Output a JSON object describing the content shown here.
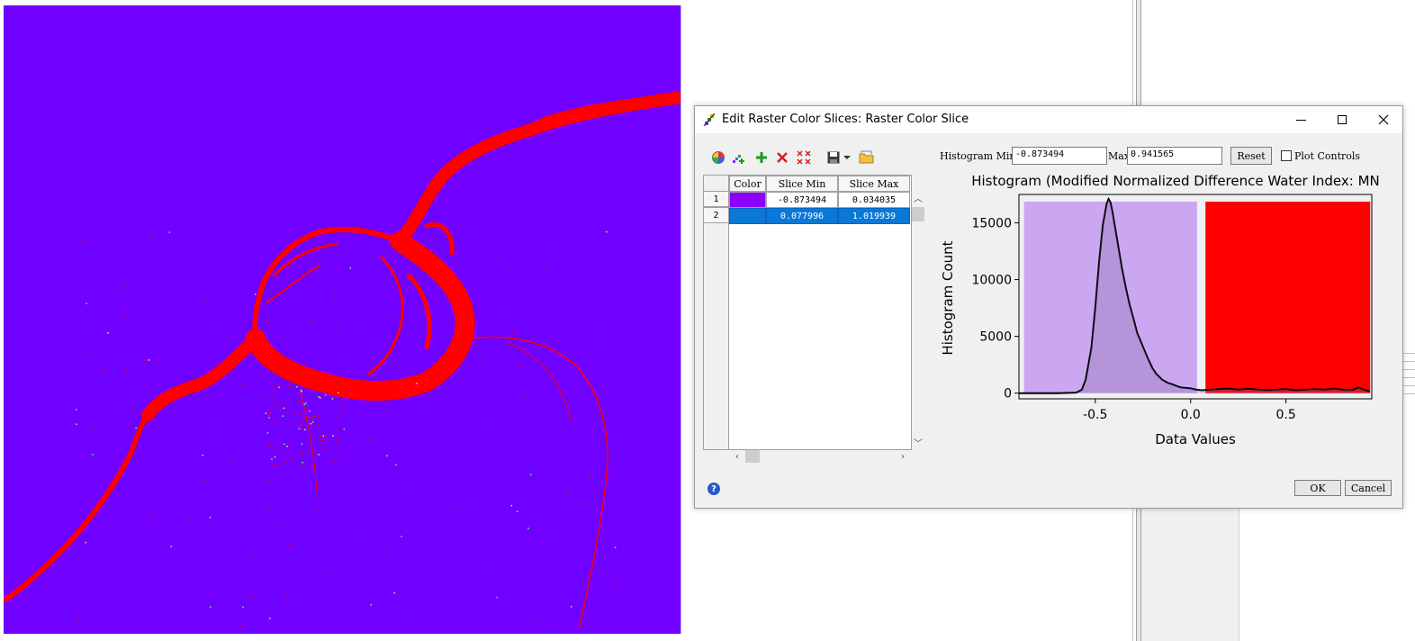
{
  "dialog": {
    "title": "Edit Raster Color Slices: Raster Color Slice",
    "ok_label": "OK",
    "cancel_label": "Cancel",
    "help_glyph": "?"
  },
  "toolbar": {
    "icons": [
      "color-wheel-icon",
      "add-ramp-icon",
      "add-icon",
      "delete-icon",
      "delete-all-icon",
      "save-icon",
      "dropdown-icon",
      "open-folder-icon"
    ]
  },
  "table": {
    "headers": [
      "Color",
      "Slice Min",
      "Slice Max"
    ],
    "rows": [
      {
        "index": "1",
        "color": "#8b00ff",
        "min": "-0.873494",
        "max": "0.034035",
        "selected": false
      },
      {
        "index": "2",
        "color": "#ff0000",
        "min": "0.077996",
        "max": "1.019939",
        "selected": true
      }
    ]
  },
  "histogram_controls": {
    "min_label": "Histogram Min",
    "min_value": "-0.873494",
    "max_label": "Max",
    "max_value": "0.941565",
    "reset_label": "Reset",
    "plot_controls_label": "Plot Controls",
    "plot_controls_checked": false
  },
  "colors": {
    "map_background": "#7000ff",
    "water": "#ff0000",
    "slice1_band": "#cba7f1",
    "slice2_band": "#ff0000",
    "selection": "#0a78d7"
  },
  "chart_data": {
    "type": "line",
    "title": "Histogram (Modified Normalized Difference Water Index: MN",
    "xlabel": "Data Values",
    "ylabel": "Histogram Count",
    "xlim": [
      -0.9,
      0.95
    ],
    "ylim": [
      -500,
      17500
    ],
    "xticks": [
      -0.5,
      0.0,
      0.5
    ],
    "xtick_labels": [
      "-0.5",
      "0.0",
      "0.5"
    ],
    "yticks": [
      0,
      5000,
      10000,
      15000
    ],
    "ytick_labels": [
      "0",
      "5000",
      "10000",
      "15000"
    ],
    "grid": false,
    "bands": [
      {
        "from": -0.873494,
        "to": 0.034035,
        "color": "#cba7f1"
      },
      {
        "from": 0.077996,
        "to": 0.941565,
        "color": "#ff0000"
      }
    ],
    "series": [
      {
        "x": [
          -0.9,
          -0.7,
          -0.6,
          -0.57,
          -0.55,
          -0.52,
          -0.5,
          -0.48,
          -0.46,
          -0.44,
          -0.43,
          -0.42,
          -0.41,
          -0.4,
          -0.38,
          -0.36,
          -0.34,
          -0.32,
          -0.3,
          -0.28,
          -0.26,
          -0.24,
          -0.22,
          -0.2,
          -0.18,
          -0.15,
          -0.12,
          -0.1,
          -0.07,
          -0.05,
          -0.02,
          0.0,
          0.03,
          0.06,
          0.1,
          0.15,
          0.2,
          0.25,
          0.3,
          0.35,
          0.4,
          0.45,
          0.5,
          0.55,
          0.6,
          0.65,
          0.7,
          0.75,
          0.8,
          0.85,
          0.88,
          0.91,
          0.94
        ],
        "y": [
          0,
          0,
          50,
          300,
          1200,
          4000,
          7500,
          11500,
          14800,
          16700,
          17100,
          16800,
          16000,
          15000,
          13000,
          11000,
          9300,
          7800,
          6600,
          5300,
          4500,
          3700,
          2900,
          2200,
          1700,
          1200,
          900,
          800,
          600,
          500,
          450,
          420,
          300,
          250,
          300,
          350,
          400,
          300,
          380,
          320,
          260,
          300,
          350,
          250,
          300,
          350,
          300,
          400,
          300,
          280,
          500,
          300,
          150
        ]
      }
    ]
  }
}
